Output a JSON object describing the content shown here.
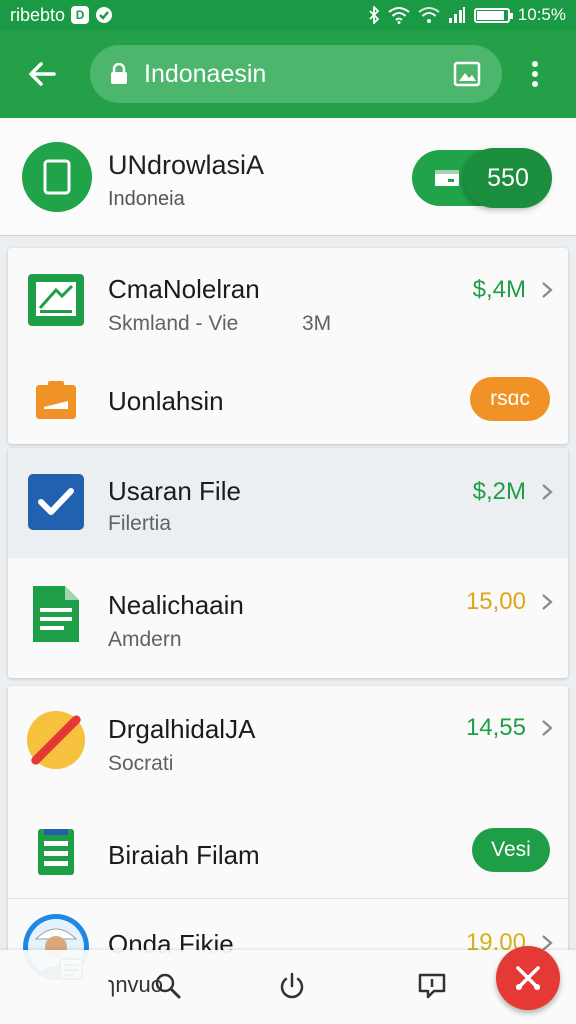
{
  "status_bar": {
    "left_text": "ribebto",
    "badge": "D",
    "time": "10:5%",
    "battery_fill": 0.9
  },
  "app_bar": {
    "search_text": "Indonaesin",
    "icons": [
      "back-arrow-icon",
      "lock-icon",
      "image-icon",
      "more-vert-icon"
    ]
  },
  "header": {
    "title": "UNdrowlasiA",
    "subtitle": "Indoneia",
    "pill_value": "550"
  },
  "rows": [
    {
      "name": "CmaNolelran",
      "meta": "Skmland - Vie",
      "meta2": "3M",
      "value": "$,4M",
      "value_color": "#1e9e46",
      "icon": "spreadsheet-icon"
    },
    {
      "name": "Uonlahsin",
      "tag": "rsɑc",
      "tag_color": "#f09226",
      "icon": "folder-icon"
    },
    {
      "name": "Usaran File",
      "meta": "Filertia",
      "value": "$,2M",
      "value_color": "#1e9e46",
      "icon": "checkbox-icon"
    },
    {
      "name": "Nealichaain",
      "meta": "Amdern",
      "value": "15,00",
      "value_color": "#e0a418",
      "icon": "document-icon"
    },
    {
      "name": "DrgalhidalJA",
      "meta": "Socrati",
      "value": "14,55",
      "value_color": "#1e9e46",
      "icon": "no-entry-icon"
    },
    {
      "name": "Biraiah Filam",
      "tag": "Vesi",
      "tag_color": "#1e9e46",
      "icon": "file-list-icon"
    },
    {
      "name": "Onda Fikie",
      "value": "19,00",
      "value_color": "#d4b21a",
      "icon": "avatar-icon"
    }
  ],
  "bottom_bar": {
    "label": "ɿnvuo",
    "icons": [
      "search-icon",
      "power-icon",
      "chat-icon",
      "close-icon"
    ]
  }
}
